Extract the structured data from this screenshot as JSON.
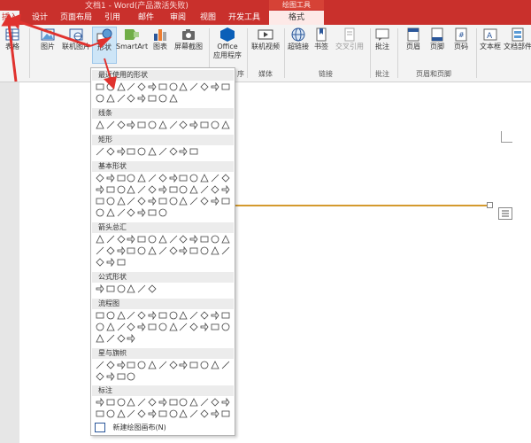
{
  "window": {
    "title": "文档1 - Word(产品激活失败)",
    "context_title": "绘图工具"
  },
  "tabs": [
    {
      "label": "插入",
      "active": true
    },
    {
      "label": "设计"
    },
    {
      "label": "页面布局"
    },
    {
      "label": "引用"
    },
    {
      "label": "邮件"
    },
    {
      "label": "审阅"
    },
    {
      "label": "视图"
    },
    {
      "label": "开发工具"
    },
    {
      "label": "格式",
      "context": true
    }
  ],
  "ribbon": {
    "buttons": {
      "table": "表格",
      "picture": "图片",
      "online_picture": "联机图片",
      "shape": "形状",
      "smartart": "SmartArt",
      "chart": "图表",
      "screenshot": "屏幕截图",
      "office_l1": "Office",
      "office_l2": "应用程序",
      "online_video": "联机视频",
      "hyperlink": "超链接",
      "bookmark": "书签",
      "crossref": "交叉引用",
      "comment": "批注",
      "header": "页眉",
      "footer": "页脚",
      "pagenum": "页码",
      "textbox": "文本框",
      "docparts": "文档部件"
    },
    "groups": {
      "table": "表格",
      "apps": "序",
      "media": "媒体",
      "links": "链接",
      "comments": "批注",
      "header_footer": "页眉和页脚"
    }
  },
  "shapes_panel": {
    "sections": {
      "recent": "最近使用的形状",
      "lines": "线条",
      "rect": "矩形",
      "basic": "基本形状",
      "arrows": "箭头总汇",
      "equation": "公式形状",
      "flowchart": "流程图",
      "stars": "星与旗帜",
      "callouts": "标注"
    },
    "new_canvas": "新建绘图画布(N)"
  },
  "colors": {
    "accent": "#c9302c",
    "selected": "#cde5f7",
    "line": "#d49a2e"
  }
}
